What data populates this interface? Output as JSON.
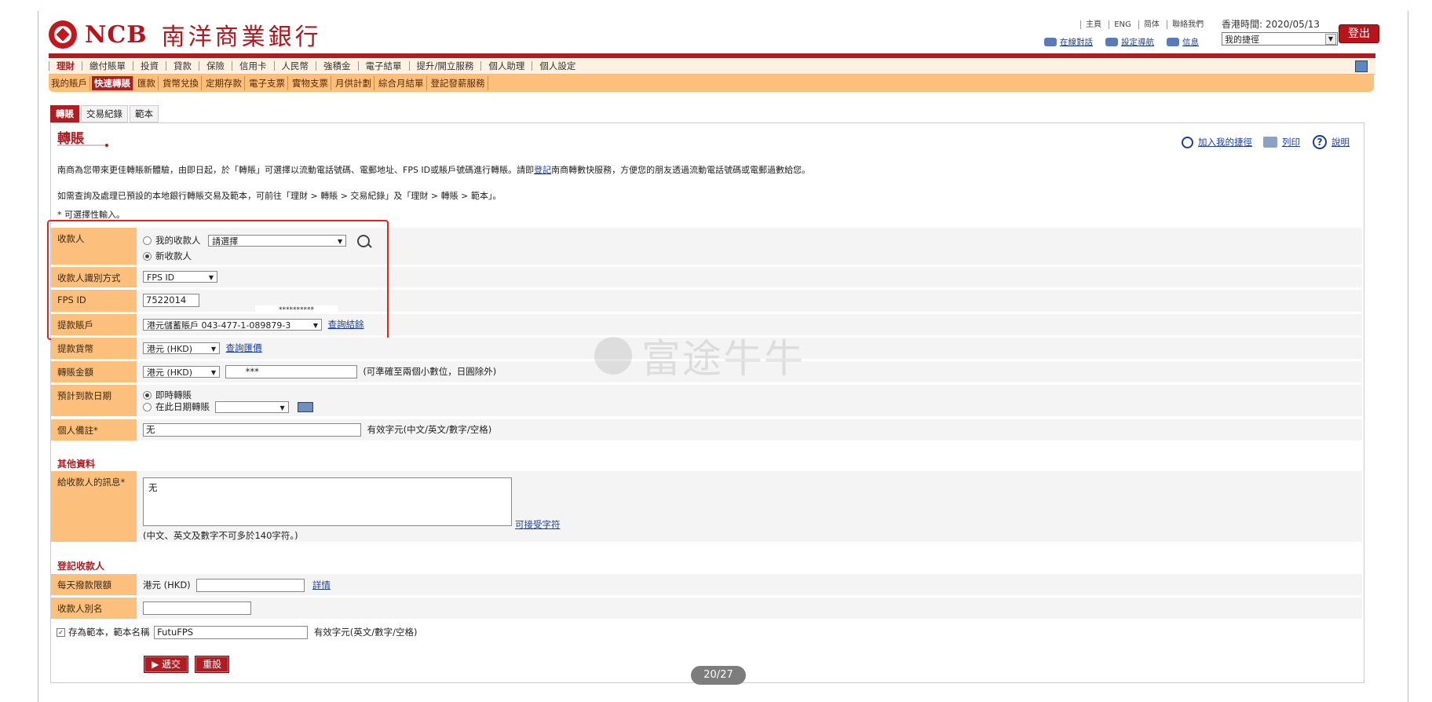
{
  "header": {
    "logo_en": "NCB",
    "logo_cn": "南洋商業銀行",
    "top_links": [
      "主頁",
      "ENG",
      "简体",
      "聯絡我們"
    ],
    "hk_time": "香港時間: 2020/05/13",
    "sub_links": [
      "在線對話",
      "設定導航",
      "信息"
    ],
    "quick_select": "我的捷徑",
    "logout": "登出"
  },
  "nav": {
    "main": [
      "理財",
      "繳付賬單",
      "投資",
      "貸款",
      "保險",
      "信用卡",
      "人民幣",
      "強積金",
      "電子結單",
      "提升/開立服務",
      "個人助理",
      "個人設定"
    ],
    "sub": [
      "我的賬戶",
      "快速轉賬",
      "匯款",
      "貨幣兌換",
      "定期存款",
      "電子支票",
      "實物支票",
      "月供計劃",
      "綜合月結單",
      "登記發薪服務"
    ]
  },
  "tabs": [
    "轉賬",
    "交易紀錄",
    "範本"
  ],
  "page": {
    "title": "轉賬",
    "right_links": [
      "加入我的捷徑",
      "列印",
      "說明"
    ],
    "intro1": "南商為您帶來更佳轉賬新體驗，由即日起，於「轉賬」可選擇以流動電話號碼、電郵地址、FPS ID或賬戶號碼進行轉賬。請即",
    "intro1_link": "登記",
    "intro1_tail": "南商轉數快服務，方便您的朋友透過流動電話號碼或電郵過數給您。",
    "intro2": "如需查詢及處理已預設的本地銀行轉賬交易及範本，可前往「理財 > 轉賬 > 交易紀錄」及「理財 > 轉賬 > 範本」。",
    "optional_note": "* 可選擇性輸入。"
  },
  "form": {
    "payee_label": "收款人",
    "payee_opt1": "我的收款人",
    "payee_select": "請選擇",
    "payee_opt2": "新收款人",
    "idmethod_label": "收款人識別方式",
    "idmethod_value": "FPS ID",
    "fpsid_label": "FPS ID",
    "fpsid_value": "7522014",
    "fpsid_mask": "**********",
    "account_label": "提款賬戶",
    "account_value": "港元儲蓄賬戶 043-477-1-089879-3",
    "account_link": "查詢結餘",
    "currency_label": "提款貨幣",
    "currency_value": "港元 (HKD)",
    "currency_link": "查詢匯價",
    "amount_label": "轉賬金額",
    "amount_currency": "港元 (HKD)",
    "amount_value": "***",
    "amount_note": "(可準確至兩個小數位，日圓除外)",
    "date_label": "預計到款日期",
    "date_opt1": "即時轉賬",
    "date_opt2": "在此日期轉賬",
    "remark_label": "個人備註*",
    "remark_value": "无",
    "remark_note": "有效字元(中文/英文/數字/空格)",
    "other_section": "其他資料",
    "message_label": "給收款人的訊息*",
    "message_value": "无",
    "message_link": "可接受字符",
    "message_note": "(中文、英文及數字不可多於140字符。)",
    "register_section": "登記收款人",
    "limit_label": "每天撥款限額",
    "limit_currency": "港元 (HKD)",
    "limit_link": "詳情",
    "alias_label": "收款人別名",
    "template_label": "存為範本，範本名稱",
    "template_value": "FutuFPS",
    "template_note": "有效字元(英文/數字/空格)",
    "submit": "遞交",
    "reset": "重設"
  },
  "overlay": {
    "watermark": "富途牛牛",
    "page_counter": "20/27"
  },
  "colors": {
    "brand_red": "#b01c22",
    "label_orange": "#fcbf7c",
    "highlight_box": "#e1251b"
  }
}
